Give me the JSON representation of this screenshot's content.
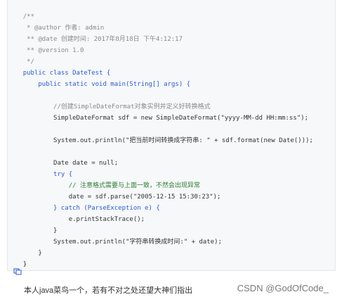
{
  "code": {
    "lines": [
      "/**",
      " * @author 作者: admin",
      " ** @date 创建时间: 2017年8月18日 下午4:12:17",
      " ** @version 1.0",
      " */",
      "public class DateTest {",
      "    public static void main(String[] args) {",
      "",
      "        //创建SimpleDateFormat对象实例并定义好转换格式",
      "        SimpleDateFormat sdf = new SimpleDateFormat(\"yyyy-MM-dd HH:mm:ss\");",
      "",
      "        System.out.println(\"把当前时间转换成字符串: \" + sdf.format(new Date()));",
      "",
      "        Date date = null;",
      "        try {",
      "            // 注意格式需要与上面一致，不然会出现异常",
      "            date = sdf.parse(\"2005-12-15 15:30:23\");",
      "        } catch (ParseException e) {",
      "            e.printStackTrace();",
      "        }",
      "        System.out.println(\"字符串转换成时间:\" + date);",
      "    }",
      "}"
    ]
  },
  "footer": {
    "note": "本人java菜鸟一个，若有不对之处还望大神们指出",
    "watermark": "CSDN @GodOfCode_"
  },
  "icons": {
    "copy": "copy-code-icon"
  }
}
